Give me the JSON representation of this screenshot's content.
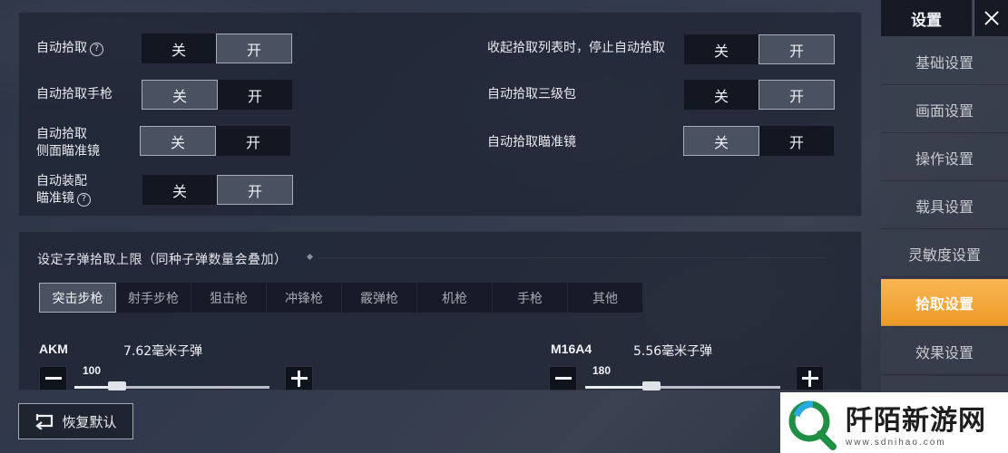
{
  "pickup_toggles": [
    {
      "label": "自动拾取",
      "has_help": true,
      "off": "关",
      "on": "开",
      "state": "on"
    },
    {
      "label": "自动拾取手枪",
      "has_help": false,
      "off": "关",
      "on": "开",
      "state": "off"
    },
    {
      "label_line1": "自动拾取",
      "label_line2": "侧面瞄准镜",
      "off": "关",
      "on": "开",
      "state": "off"
    },
    {
      "label_line1": "自动装配",
      "label_line2": "瞄准镜",
      "has_help": true,
      "off": "关",
      "on": "开",
      "state": "on"
    },
    {
      "label": "收起拾取列表时，停止自动拾取",
      "off": "关",
      "on": "开",
      "state": "on"
    },
    {
      "label": "自动拾取三级包",
      "off": "关",
      "on": "开",
      "state": "on"
    },
    {
      "label": "自动拾取瞄准镜",
      "off": "关",
      "on": "开",
      "state": "off"
    }
  ],
  "ammo_section": {
    "title": "设定子弹拾取上限（同种子弹数量会叠加）",
    "tabs": [
      "突击步枪",
      "射手步枪",
      "狙击枪",
      "冲锋枪",
      "霰弹枪",
      "机枪",
      "手枪",
      "其他"
    ],
    "active_tab": "突击步枪",
    "guns": [
      {
        "name": "AKM",
        "ammo": "7.62毫米子弹",
        "value": "100",
        "fill_fraction": 0.22
      },
      {
        "name": "M16A4",
        "ammo": "5.56毫米子弹",
        "value": "180",
        "fill_fraction": 0.34
      }
    ]
  },
  "sidebar": {
    "title": "设置",
    "items": [
      "基础设置",
      "画面设置",
      "操作设置",
      "载具设置",
      "灵敏度设置",
      "拾取设置",
      "效果设置"
    ],
    "active": "拾取设置"
  },
  "reset_label": "恢复默认",
  "watermark": {
    "main": "阡陌新游网",
    "sub": "www.sdnihao.com"
  },
  "colors": {
    "accent": "#f0a030",
    "toggle_on": "#4a5161",
    "toggle_off": "#121722"
  },
  "icons": [
    "help-icon",
    "close-icon",
    "minus-icon",
    "plus-icon",
    "reset-icon"
  ]
}
